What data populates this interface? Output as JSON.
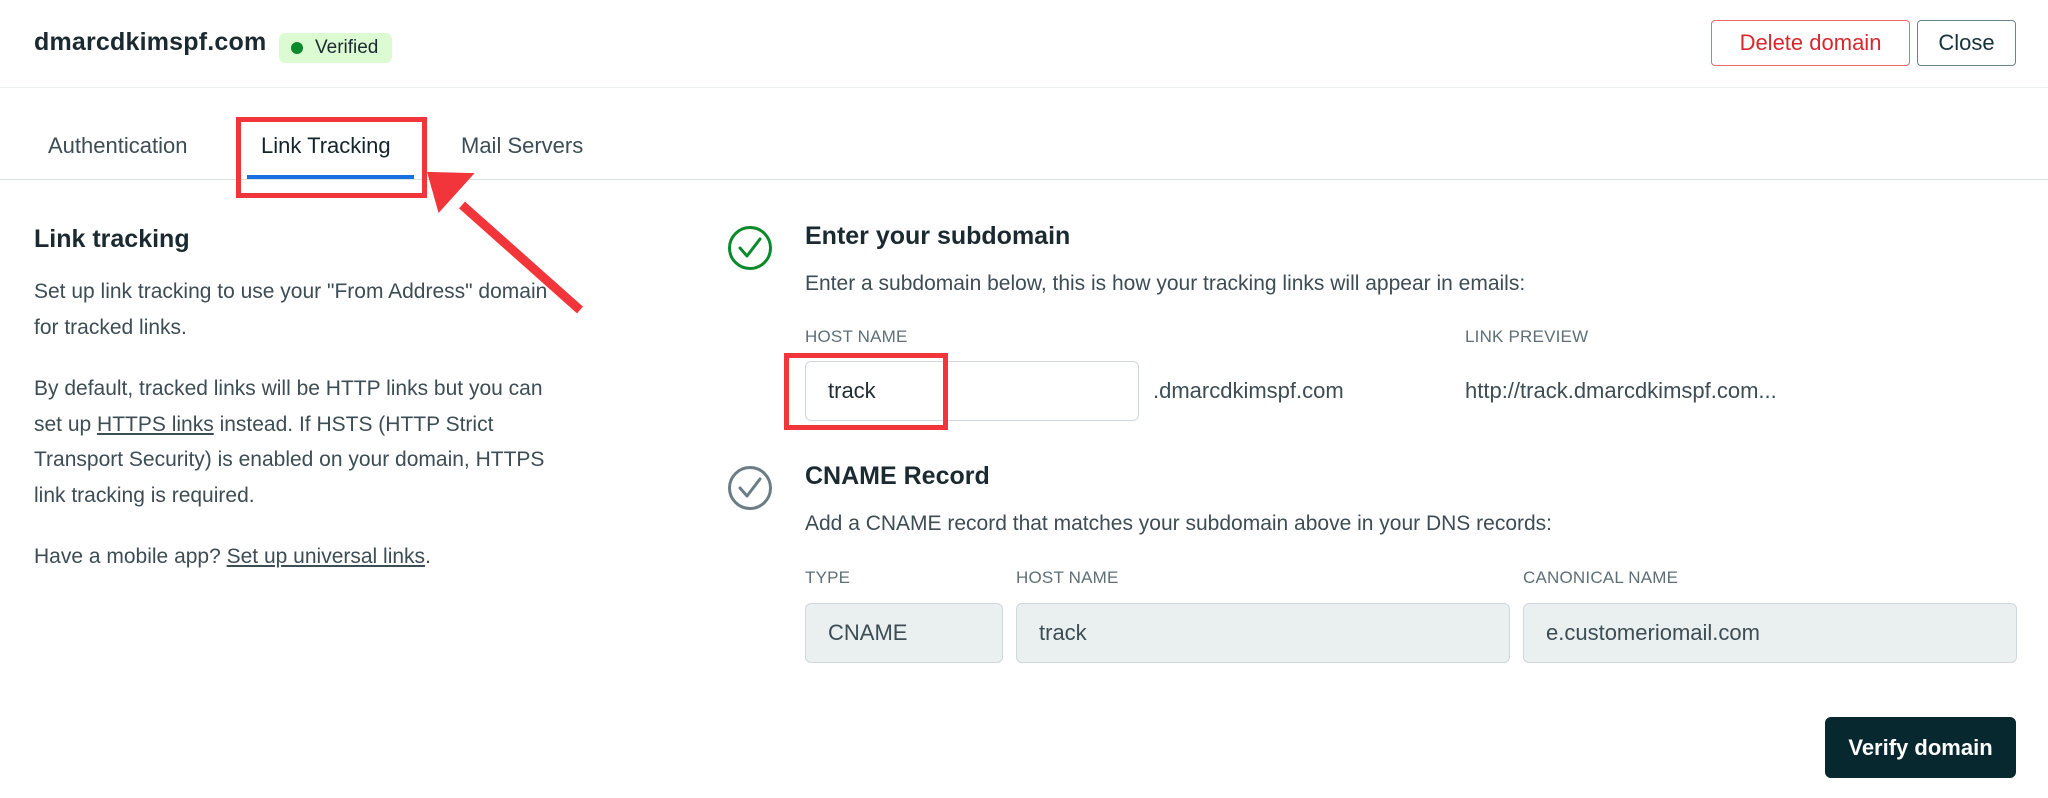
{
  "header": {
    "domain": "dmarcdkimspf.com",
    "status_badge": "Verified",
    "status_color": "#0a8a2a",
    "delete_label": "Delete domain",
    "close_label": "Close"
  },
  "tabs": [
    {
      "label": "Authentication",
      "active": false
    },
    {
      "label": "Link Tracking",
      "active": true
    },
    {
      "label": "Mail Servers",
      "active": false
    }
  ],
  "left": {
    "title": "Link tracking",
    "intro": "Set up link tracking to use your \"From Address\" domain for tracked links.",
    "https_pre": "By default, tracked links will be HTTP links but you can set up ",
    "https_link": "HTTPS links",
    "https_post": " instead. If HSTS (HTTP Strict Transport Security) is enabled on your domain, HTTPS link tracking is required.",
    "mobile_pre": "Have a mobile app? ",
    "mobile_link": "Set up universal links",
    "mobile_post": "."
  },
  "step1": {
    "icon": "check-circle-icon",
    "status": "complete",
    "title": "Enter your subdomain",
    "description": "Enter a subdomain below, this is how your tracking links will appear in emails:",
    "host_label": "HOST NAME",
    "host_value": "track",
    "host_suffix": ".dmarcdkimspf.com",
    "preview_label": "LINK PREVIEW",
    "preview_value": "http://track.dmarcdkimspf.com..."
  },
  "step2": {
    "icon": "check-circle-icon",
    "status": "pending",
    "title": "CNAME Record",
    "description": "Add a CNAME record that matches your subdomain above in your DNS records:",
    "type_label": "TYPE",
    "type_value": "CNAME",
    "host_label": "HOST NAME",
    "host_value": "track",
    "canonical_label": "CANONICAL NAME",
    "canonical_value": "e.customeriomail.com"
  },
  "footer": {
    "verify_label": "Verify domain"
  },
  "colors": {
    "accent_tab": "#1a6fe0",
    "annotation": "#f2353a",
    "delete": "#d9272e",
    "primary_button": "#082830",
    "complete": "#0a8a2a",
    "pending": "#6b7d84"
  }
}
